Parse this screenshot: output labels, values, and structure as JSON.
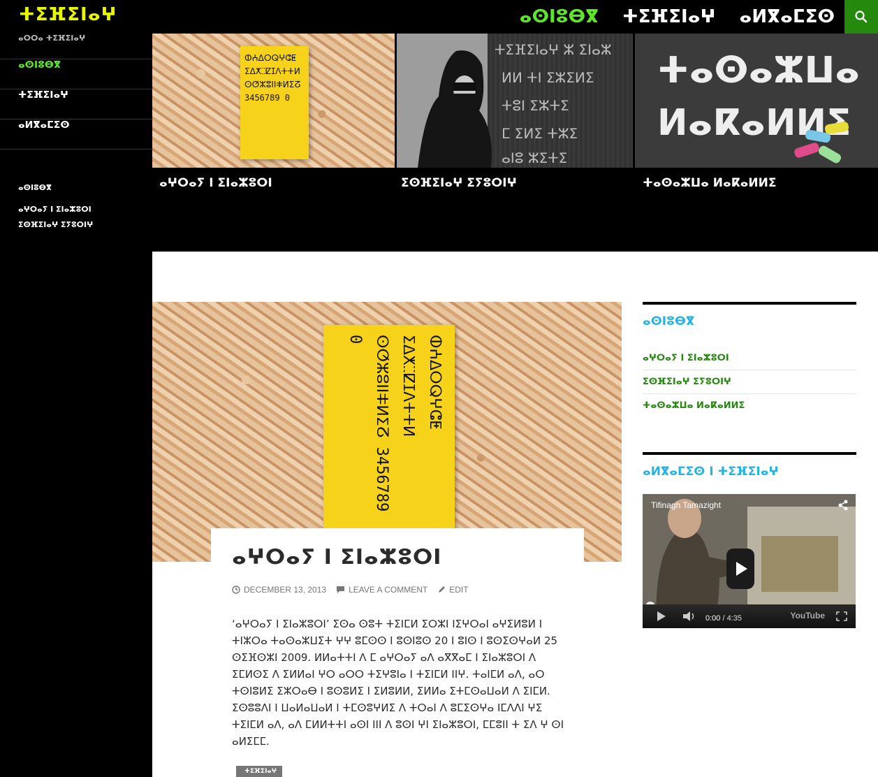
{
  "header": {
    "site_title": "ⵜⵉⴼⵉⵏⴰⵖ",
    "nav": [
      {
        "label": "ⴰⵙⵏⵓⴱⴳ",
        "active": true
      },
      {
        "label": "ⵜⵉⴼⵉⵏⴰⵖ",
        "active": false
      },
      {
        "label": "ⴰⵍⴳⴰⵎⵉⵙ",
        "active": false
      }
    ],
    "search_icon": "search-icon",
    "accent": "#24890d",
    "title_color": "#e7f500",
    "active_color": "#5ce629"
  },
  "sidebar": {
    "tagline": "ⴰⵔⵔⴰ ⵜⵉⴼⵉⵏⴰⵖ",
    "nav": [
      {
        "label": "ⴰⵙⵏⵓⴱⴳ",
        "active": true
      },
      {
        "label": "ⵜⵉⴼⵉⵏⴰⵖ",
        "active": false
      },
      {
        "label": "ⴰⵍⴳⴰⵎⵉⵙ",
        "active": false
      }
    ],
    "widget_title": "ⴰⵙⵏⵓⴱⴳ",
    "widget_links": [
      "ⴰⵖⵔⴰⵢ ⵏ ⵉⵏⴰⵣⵓⵔⵏ",
      "ⵉⵙⴼⵉⵏⴰⵖ ⵉⵢⵓⵔⵏⵖ"
    ]
  },
  "featured": [
    {
      "title": "ⴰⵖⵔⴰⵢ ⵏ ⵉⵏⴰⵣⵓⵔⵏ"
    },
    {
      "title": "ⵉⵙⴼⵉⵏⴰⵖ ⵉⵢⵓⵔⵏⵖ"
    },
    {
      "title": "ⵜⴰⵙⴰⵣⵡⴰ ⵍⴰⴽⴰⵍⵍⵉ"
    }
  ],
  "post": {
    "title": "ⴰⵖⵔⴰⵢ ⵏ ⵉⵏⴰⵣⵓⵔⵏ",
    "date": "DECEMBER 13, 2013",
    "comment": "LEAVE A COMMENT",
    "edit": "EDIT",
    "body": "‘ⴰⵖⵔⴰⵢ ⵏ ⵉⵏⴰⵣⵓⵔⵏ’ ⵉⵙⴰ ⵙⵓⵜ ⵜⵉⵏⵎⵍ ⵉⵔⵣⵏ ⵏⵉⵖⵔⴰⵏ ⴰⵖⵉⵍⵓⵍ ⵏ ⵜⵏⵣⵔⴰ ⵜⴰⵙⴰⵣⵡⵉⵜ ⵖⵖ ⵓⵎⵙⵙ ⵏ ⵓⵙⵏⵓⵙ 20 ⵏ ⵓⵏⵙ ⵏ ⵓⵙⵉⵙⵖⴰⵍ 25 ⵙⵉⴼⵙⵣⵏ 2009. ⵍⵍⴰⵜⵜⵏ ⴷ ⵎ ⴰⵖⵔⴰⵢ ⴰⴷ ⴰⴳⴳⴰⵎ ⵏ ⵉⵏⴰⵣⵓⵔⵏ ⴷ ⵉⵎⵍⵙⵉ ⴷ ⵉⵍⵍⴰⵏ ⵖⵔ ⴰⵔⵔ ⵜⵉⵖⵓⵏⴰ ⵏ ⵜⵉⵏⵎⵍ ⵏⵏⵖ. ⵜⴰⵏⵎⵍ ⴰⴷ, ⴰⵔ ⵜⵙⵏⵓⵍⵉ ⵉⵣⵔⴰⴱ ⵏ ⵓⵙⵓⵍⵉ ⵏ ⵉⵍⵓⵍⵍ, ⵉⵍⵍⴰ ⵉⵜⵎⵙⴰⵡⴰⵍ ⴷ ⵉⵏⵎⵍ. ⵉⵙⵓⵓⴷⵏ ⵏ ⵡⴰⵍⴰⵡⴰⵍ ⵏ ⵜⵎⵙⵓⵖⵍⵉ ⴷ ⵜⵔⴰⵏ ⴷ ⵓⵎⵉⵙⵖⴰ ⵏⵎⴷⴷⵏ ⵖⵉ ⵜⵉⵏⵎⵍ ⴰⴷ, ⴰⴷ ⵎⵍⵍⵜⵜⵏ ⴰⵙⵏ ⵏⵏⵏ ⴷ ⵓⵙⵏ ⵖⵏ ⵉⵏⴰⵣⵓⵔⵏ, ⵎⵎⵓⵏⵏ ⵜ ⵉⴷ ⵖ ⵙⵏ ⴰⵍⵉⵎⵎ.",
    "tag": "ⵜⵉⴼⵉⵏⴰⵖ"
  },
  "widgets": {
    "recent_title": "ⴰⵙⵏⵓⴱⴳ",
    "recent_items": [
      "ⴰⵖⵔⴰⵢ ⵏ ⵉⵏⴰⵣⵓⵔⵏ",
      "ⵉⵙⴼⵉⵏⴰⵖ ⵉⵢⵓⵔⵏⵖ",
      "ⵜⴰⵙⴰⵣⵡⴰ ⵍⴰⴽⴰⵍⵍⵉ"
    ],
    "video_widget_title": "ⴰⵍⴳⴰⵎⵉⵙ ⵏ ⵜⵉⴼⵉⵏⴰⵖ",
    "video": {
      "title": "Tifinagh Tamazight",
      "time_current": "0:00",
      "time_total": "/ 4:35",
      "brand": "YouTube",
      "progress": 0
    }
  },
  "poster_lines": [
    "ⵀⵄⵠⵔⵕⵖⵛⵟ",
    "ⵉⵠⵅⵆⵇⵊⴷⵜⵜⵍ",
    "ⵙⵚⵣⵓⵏⵏⵐⵍⵉⵒ",
    "3456789 0"
  ]
}
